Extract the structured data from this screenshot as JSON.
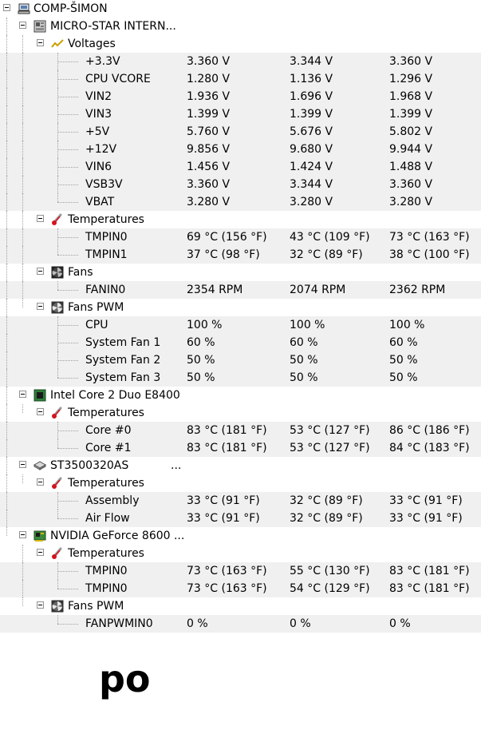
{
  "root": {
    "label": "COMP-ŠIMON",
    "icon": "computer-icon"
  },
  "hardware": [
    {
      "label": "MICRO-STAR INTERN...",
      "icon": "motherboard-icon",
      "extra": "",
      "groups": [
        {
          "label": "Voltages",
          "icon": "voltage-icon",
          "sensors": [
            {
              "name": "+3.3V",
              "v": [
                "3.360 V",
                "3.344 V",
                "3.360 V"
              ]
            },
            {
              "name": "CPU VCORE",
              "v": [
                "1.280 V",
                "1.136 V",
                "1.296 V"
              ]
            },
            {
              "name": "VIN2",
              "v": [
                "1.936 V",
                "1.696 V",
                "1.968 V"
              ]
            },
            {
              "name": "VIN3",
              "v": [
                "1.399 V",
                "1.399 V",
                "1.399 V"
              ]
            },
            {
              "name": "+5V",
              "v": [
                "5.760 V",
                "5.676 V",
                "5.802 V"
              ]
            },
            {
              "name": "+12V",
              "v": [
                "9.856 V",
                "9.680 V",
                "9.944 V"
              ]
            },
            {
              "name": "VIN6",
              "v": [
                "1.456 V",
                "1.424 V",
                "1.488 V"
              ]
            },
            {
              "name": "VSB3V",
              "v": [
                "3.360 V",
                "3.344 V",
                "3.360 V"
              ]
            },
            {
              "name": "VBAT",
              "v": [
                "3.280 V",
                "3.280 V",
                "3.280 V"
              ]
            }
          ]
        },
        {
          "label": "Temperatures",
          "icon": "thermometer-icon",
          "sensors": [
            {
              "name": "TMPIN0",
              "v": [
                "69 °C  (156 °F)",
                "43 °C  (109 °F)",
                "73 °C  (163 °F)"
              ]
            },
            {
              "name": "TMPIN1",
              "v": [
                "37 °C  (98 °F)",
                "32 °C  (89 °F)",
                "38 °C  (100 °F)"
              ]
            }
          ]
        },
        {
          "label": "Fans",
          "icon": "fan-icon",
          "sensors": [
            {
              "name": "FANIN0",
              "v": [
                "2354 RPM",
                "2074 RPM",
                "2362 RPM"
              ]
            }
          ]
        },
        {
          "label": "Fans PWM",
          "icon": "fan-pwm-icon",
          "sensors": [
            {
              "name": "CPU",
              "v": [
                "100 %",
                "100 %",
                "100 %"
              ]
            },
            {
              "name": "System Fan 1",
              "v": [
                "60 %",
                "60 %",
                "60 %"
              ]
            },
            {
              "name": "System Fan 2",
              "v": [
                "50 %",
                "50 %",
                "50 %"
              ]
            },
            {
              "name": "System Fan 3",
              "v": [
                "50 %",
                "50 %",
                "50 %"
              ]
            }
          ]
        }
      ]
    },
    {
      "label": "Intel Core 2 Duo E8400",
      "icon": "cpu-chip-icon",
      "extra": "",
      "groups": [
        {
          "label": "Temperatures",
          "icon": "thermometer-icon",
          "sensors": [
            {
              "name": "Core #0",
              "v": [
                "83 °C  (181 °F)",
                "53 °C  (127 °F)",
                "86 °C  (186 °F)"
              ]
            },
            {
              "name": "Core #1",
              "v": [
                "83 °C  (181 °F)",
                "53 °C  (127 °F)",
                "84 °C  (183 °F)"
              ]
            }
          ]
        }
      ]
    },
    {
      "label": "ST3500320AS",
      "icon": "hard-drive-icon",
      "extra": "...",
      "groups": [
        {
          "label": "Temperatures",
          "icon": "thermometer-icon",
          "sensors": [
            {
              "name": "Assembly",
              "v": [
                "33 °C  (91 °F)",
                "32 °C  (89 °F)",
                "33 °C  (91 °F)"
              ]
            },
            {
              "name": "Air Flow",
              "v": [
                "33 °C  (91 °F)",
                "32 °C  (89 °F)",
                "33 °C  (91 °F)"
              ]
            }
          ]
        }
      ]
    },
    {
      "label": "NVIDIA GeForce 8600 ...",
      "icon": "gpu-card-icon",
      "extra": "",
      "groups": [
        {
          "label": "Temperatures",
          "icon": "thermometer-icon",
          "sensors": [
            {
              "name": "TMPIN0",
              "v": [
                "73 °C  (163 °F)",
                "55 °C  (130 °F)",
                "83 °C  (181 °F)"
              ]
            },
            {
              "name": "TMPIN0",
              "v": [
                "73 °C  (163 °F)",
                "54 °C  (129 °F)",
                "83 °C  (181 °F)"
              ]
            }
          ]
        },
        {
          "label": "Fans PWM",
          "icon": "fan-pwm-icon",
          "sensors": [
            {
              "name": "FANPWMIN0",
              "v": [
                "0 %",
                "0 %",
                "0 %"
              ]
            }
          ]
        }
      ]
    }
  ],
  "footer_text": "po"
}
